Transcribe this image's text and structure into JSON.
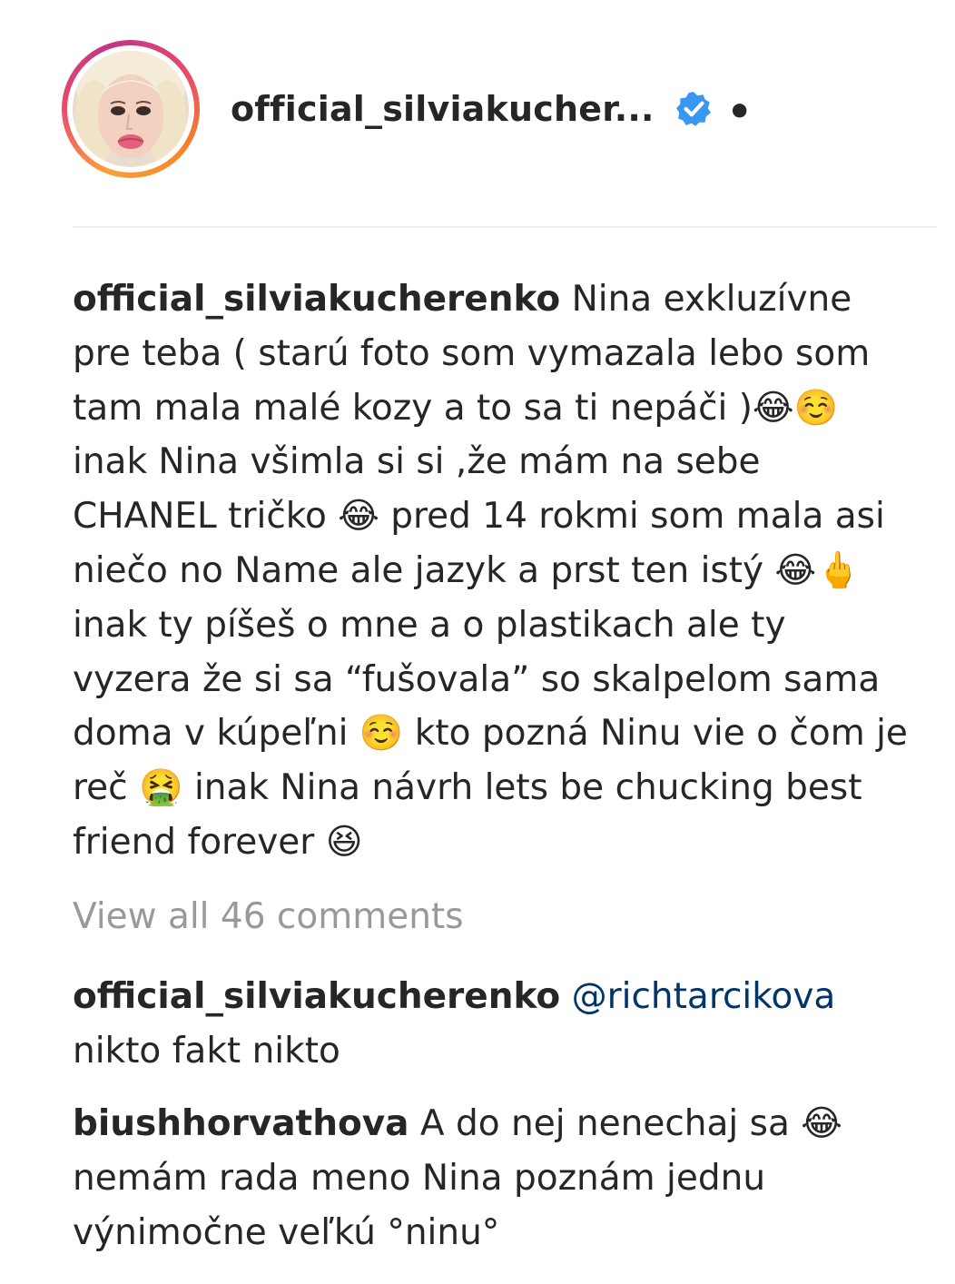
{
  "post": {
    "author": {
      "username_truncated": "official_silviakucher...",
      "verified_icon": "verified-badge-icon",
      "separator": "•"
    },
    "caption": {
      "username": "official_silviakucherenko",
      "text": " Nina exkluzívne pre teba ( starú foto som vymazala lebo som tam mala malé kozy a to sa ti nepáči )😂☺️ inak Nina všimla si si ,že mám na sebe CHANEL tričko 😂 pred 14 rokmi som mala asi niečo no Name ale jazyk a prst ten istý 😂🖕 inak ty píšeš o mne a o plastikach ale ty vyzera že si sa “fušovala” so skalpelom sama doma v kúpeľni ☺️ kto pozná Ninu vie o čom je reč 🤮 inak Nina návrh lets be chucking best friend forever 😆"
    },
    "view_all_comments": "View all 46 comments",
    "comments": [
      {
        "username": "official_silviakucherenko",
        "mention": "@richtarcikova",
        "text": " nikto fakt nikto"
      },
      {
        "username": "biushhorvathova",
        "text": " A do nej nenechaj sa 😂nemám rada meno Nina poznám jednu výnimočne veľkú °ninu°"
      }
    ],
    "colors": {
      "text": "#262626",
      "muted": "#999999",
      "mention": "#003569",
      "verified": "#3897f0",
      "divider": "#efefef",
      "story_ring_start": "#f58529",
      "story_ring_end": "#c13584"
    }
  }
}
